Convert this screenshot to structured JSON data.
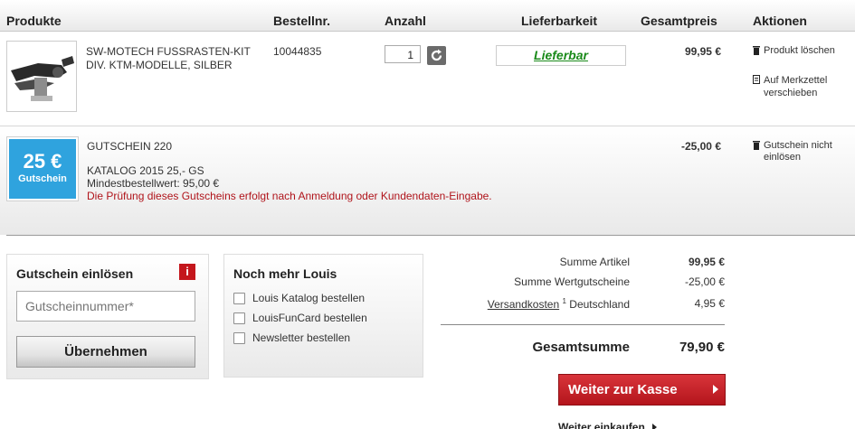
{
  "table_header": {
    "products": "Produkte",
    "order_no": "Bestellnr.",
    "quantity": "Anzahl",
    "availability": "Lieferbarkeit",
    "total_price": "Gesamtpreis",
    "actions": "Aktionen"
  },
  "product": {
    "name_line1": "SW-MOTECH FUSSRASTEN-KIT",
    "name_line2": "DIV. KTM-MODELLE, SILBER",
    "order_no": "10044835",
    "quantity": "1",
    "availability": "Lieferbar",
    "price": "99,95 €",
    "delete_label": "Produkt löschen",
    "wishlist_line1": "Auf Merkzettel",
    "wishlist_line2": "verschieben"
  },
  "voucher": {
    "badge_amount": "25 €",
    "badge_label": "Gutschein",
    "title": "GUTSCHEIN 220",
    "catalog": "KATALOG 2015 25,- GS",
    "min_order": "Mindestbestellwert: 95,00 €",
    "notice": "Die Prüfung dieses Gutscheins erfolgt nach Anmeldung oder Kundendaten-Eingabe.",
    "price": "-25,00 €",
    "delete_line1": "Gutschein nicht",
    "delete_line2": "einlösen"
  },
  "redeem": {
    "title": "Gutschein einlösen",
    "info_icon": "i",
    "placeholder": "Gutscheinnummer*",
    "button": "Übernehmen"
  },
  "more": {
    "title": "Noch mehr Louis",
    "options": [
      "Louis Katalog bestellen",
      "LouisFunCard bestellen",
      "Newsletter bestellen"
    ]
  },
  "summary": {
    "articles_label": "Summe Artikel",
    "articles_value": "99,95 €",
    "vouchers_label": "Summe Wertgutscheine",
    "vouchers_value": "-25,00 €",
    "shipping_link": "Versandkosten",
    "shipping_sup": "1",
    "shipping_country": "Deutschland",
    "shipping_value": "4,95 €",
    "total_label": "Gesamtsumme",
    "total_value": "79,90 €",
    "checkout": "Weiter zur Kasse",
    "continue": "Weiter einkaufen"
  },
  "colors": {
    "availability_green": "#1a8a1a",
    "notice_red": "#b0141b",
    "badge_blue": "#2fa3de",
    "info_red": "#c4161c",
    "checkout_red": "#c11f25"
  }
}
